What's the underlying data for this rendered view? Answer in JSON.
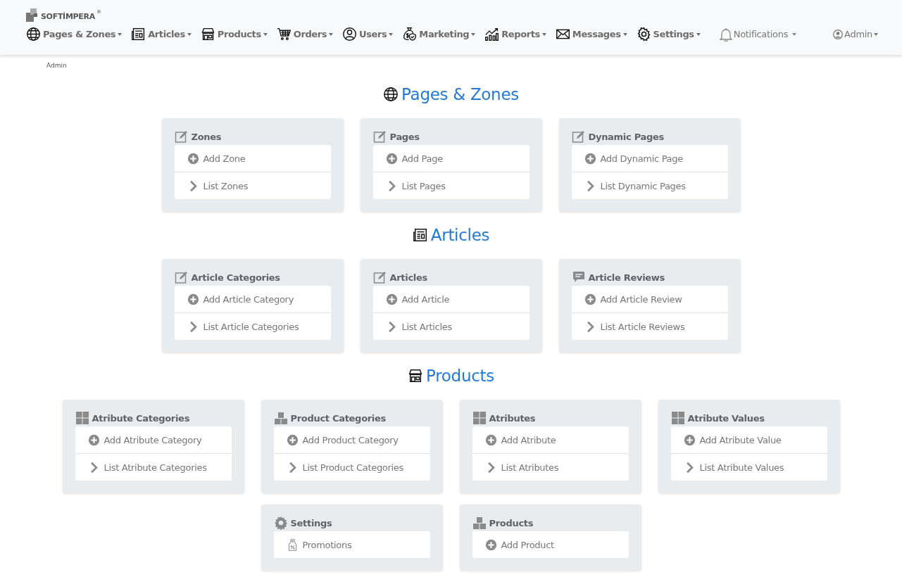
{
  "header": {
    "logo": "SOFTİMPERA",
    "logo_mark": "®",
    "nav": [
      {
        "kind": "globe",
        "label": "Pages & Zones"
      },
      {
        "kind": "newspaper",
        "label": "Articles"
      },
      {
        "kind": "store",
        "label": "Products"
      },
      {
        "kind": "cart",
        "label": "Orders"
      },
      {
        "kind": "user",
        "label": "Users"
      },
      {
        "kind": "moneybag",
        "label": "Marketing"
      },
      {
        "kind": "chart",
        "label": "Reports"
      },
      {
        "kind": "envelope",
        "label": "Messages"
      },
      {
        "kind": "gear",
        "label": "Settings"
      }
    ],
    "notifications": "Notifications",
    "user_menu": "Admin"
  },
  "breadcrumb": "Admin",
  "sections": [
    {
      "kind": "globe",
      "title": "Pages & Zones",
      "cards": [
        {
          "kind": "edit",
          "title": "Zones",
          "items": [
            {
              "kind": "add",
              "label": "Add Zone"
            },
            {
              "kind": "list",
              "label": "List Zones"
            }
          ]
        },
        {
          "kind": "edit",
          "title": "Pages",
          "items": [
            {
              "kind": "add",
              "label": "Add Page"
            },
            {
              "kind": "list",
              "label": "List Pages"
            }
          ]
        },
        {
          "kind": "edit",
          "title": "Dynamic Pages",
          "items": [
            {
              "kind": "add",
              "label": "Add Dynamic Page"
            },
            {
              "kind": "list",
              "label": "List Dynamic Pages"
            }
          ]
        }
      ]
    },
    {
      "kind": "newspaper",
      "title": "Articles",
      "cards": [
        {
          "kind": "edit",
          "title": "Article Categories",
          "items": [
            {
              "kind": "add",
              "label": "Add Article Category"
            },
            {
              "kind": "list",
              "label": "List Article Categories"
            }
          ]
        },
        {
          "kind": "edit",
          "title": "Articles",
          "items": [
            {
              "kind": "add",
              "label": "Add Article"
            },
            {
              "kind": "list",
              "label": "List Articles"
            }
          ]
        },
        {
          "kind": "comment",
          "title": "Article Reviews",
          "items": [
            {
              "kind": "add",
              "label": "Add Article Review"
            },
            {
              "kind": "list",
              "label": "List Article Reviews"
            }
          ]
        }
      ]
    },
    {
      "kind": "store",
      "title": "Products",
      "cards": [
        {
          "kind": "grid",
          "title": "Atribute Categories",
          "items": [
            {
              "kind": "add",
              "label": "Add Atribute Category"
            },
            {
              "kind": "list",
              "label": "List Atribute Categories"
            }
          ]
        },
        {
          "kind": "boxes",
          "title": "Product Categories",
          "items": [
            {
              "kind": "add",
              "label": "Add Product Category"
            },
            {
              "kind": "list",
              "label": "List Product Categories"
            }
          ]
        },
        {
          "kind": "grid",
          "title": "Atributes",
          "items": [
            {
              "kind": "add",
              "label": "Add Atribute"
            },
            {
              "kind": "list",
              "label": "List Atributes"
            }
          ]
        },
        {
          "kind": "grid",
          "title": "Atribute Values",
          "items": [
            {
              "kind": "add",
              "label": "Add Atribute Value"
            },
            {
              "kind": "list",
              "label": "List Atribute Values"
            }
          ]
        },
        {
          "kind": "gear",
          "title": "Settings",
          "items": [
            {
              "kind": "promo",
              "label": "Promotions"
            }
          ]
        },
        {
          "kind": "boxes",
          "title": "Products",
          "items": [
            {
              "kind": "add",
              "label": "Add Product"
            }
          ]
        }
      ]
    }
  ]
}
